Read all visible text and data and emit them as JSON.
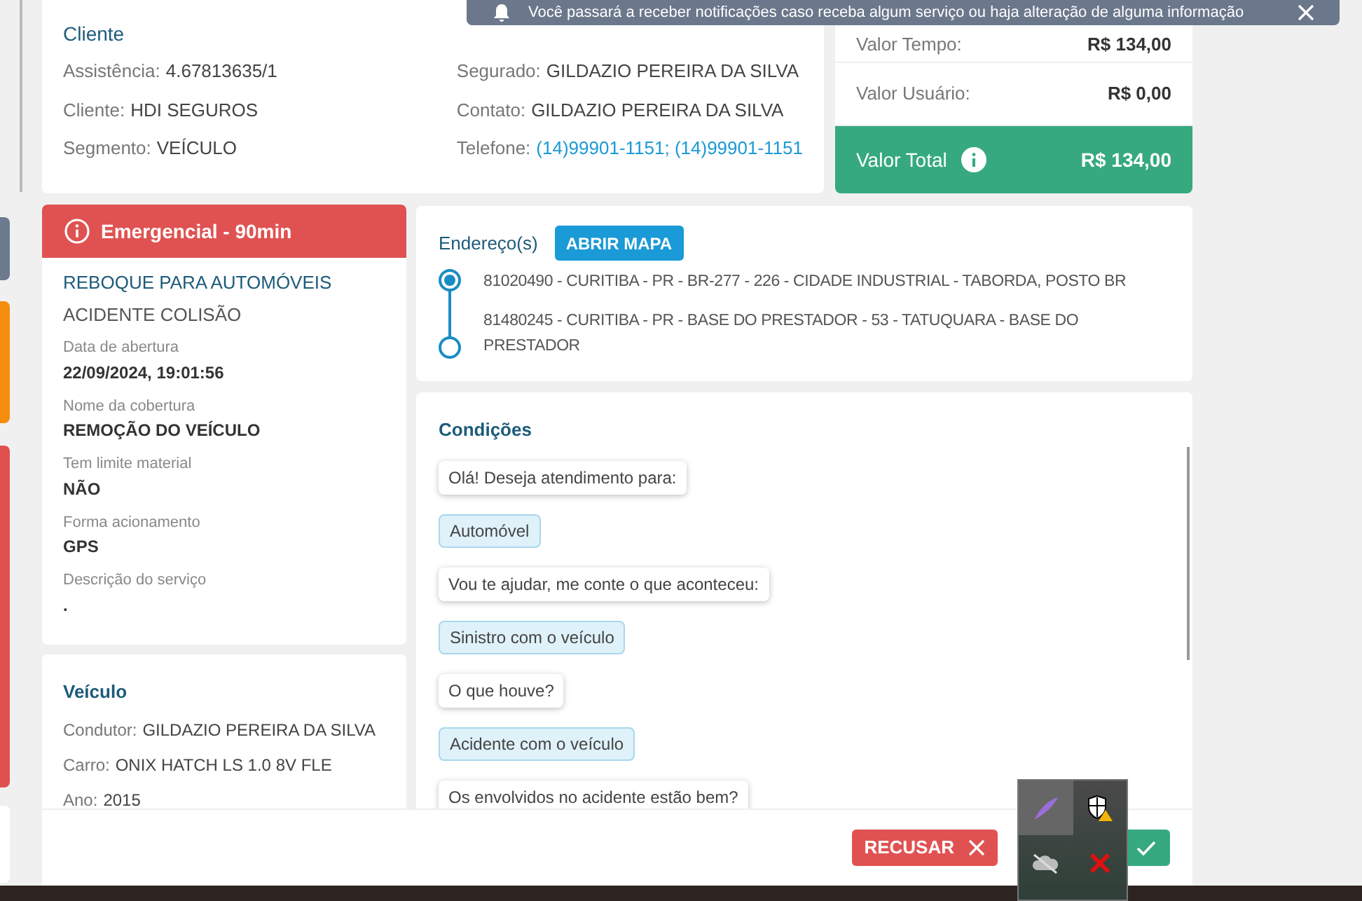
{
  "notification": {
    "text": "Você passará a receber notificações caso receba algum serviço ou haja alteração de alguma informação"
  },
  "cliente": {
    "title": "Cliente",
    "columns": [
      [
        {
          "label": "Assistência:",
          "value": "4.67813635/1",
          "kind": "text"
        },
        {
          "label": "Cliente:",
          "value": "HDI SEGUROS",
          "kind": "text"
        },
        {
          "label": "Segmento:",
          "value": "VEÍCULO",
          "kind": "text"
        }
      ],
      [
        {
          "label": "Segurado:",
          "value": "GILDAZIO PEREIRA DA SILVA",
          "kind": "text"
        },
        {
          "label": "Contato:",
          "value": "GILDAZIO PEREIRA DA SILVA",
          "kind": "text"
        },
        {
          "label": "Telefone:",
          "value": "(14)99901-1151; (14)99901-1151",
          "kind": "link"
        }
      ]
    ]
  },
  "valores": {
    "rows": [
      {
        "label": "Valor Tempo:",
        "value": "R$ 134,00"
      },
      {
        "label": "Valor Usuário:",
        "value": "R$ 0,00"
      }
    ],
    "total": {
      "label": "Valor Total",
      "value": "R$ 134,00"
    }
  },
  "servico": {
    "priority": "Emergencial - 90min",
    "title": "REBOQUE PARA AUTOMÓVEIS",
    "subtitle": "ACIDENTE COLISÃO",
    "fields": [
      {
        "label": "Data de abertura",
        "value": "22/09/2024, 19:01:56"
      },
      {
        "label": "Nome da cobertura",
        "value": "REMOÇÃO DO VEÍCULO"
      },
      {
        "label": "Tem limite material",
        "value": "NÃO"
      },
      {
        "label": "Forma acionamento",
        "value": "GPS"
      },
      {
        "label": "Descrição do serviço",
        "value": "."
      }
    ]
  },
  "veiculo": {
    "title": "Veículo",
    "fields": [
      {
        "label": "Condutor:",
        "value": "GILDAZIO PEREIRA DA SILVA"
      },
      {
        "label": "Carro:",
        "value": "ONIX HATCH LS 1.0 8V FLE"
      },
      {
        "label": "Ano:",
        "value": "2015"
      }
    ]
  },
  "enderecos": {
    "title": "Endereço(s)",
    "button": "ABRIR MAPA",
    "items": [
      {
        "text": "81020490 - CURITIBA - PR - BR-277 - 226 - CIDADE INDUSTRIAL - TABORDA, POSTO BR",
        "selected": true
      },
      {
        "text": "81480245 - CURITIBA - PR - BASE DO PRESTADOR - 53 - TATUQUARA - BASE DO PRESTADOR",
        "selected": false
      }
    ]
  },
  "condicoes": {
    "title": "Condições",
    "messages": [
      {
        "text": "Olá! Deseja atendimento para:",
        "kind": "bot"
      },
      {
        "text": "Automóvel",
        "kind": "user"
      },
      {
        "text": "Vou te ajudar, me conte o que aconteceu:",
        "kind": "bot"
      },
      {
        "text": "Sinistro com o veículo",
        "kind": "user"
      },
      {
        "text": "O que houve?",
        "kind": "bot"
      },
      {
        "text": "Acidente com o veículo",
        "kind": "user"
      },
      {
        "text": "Os envolvidos no acidente estão bem?",
        "kind": "bot"
      }
    ]
  },
  "footer": {
    "reject": "RECUSAR"
  }
}
